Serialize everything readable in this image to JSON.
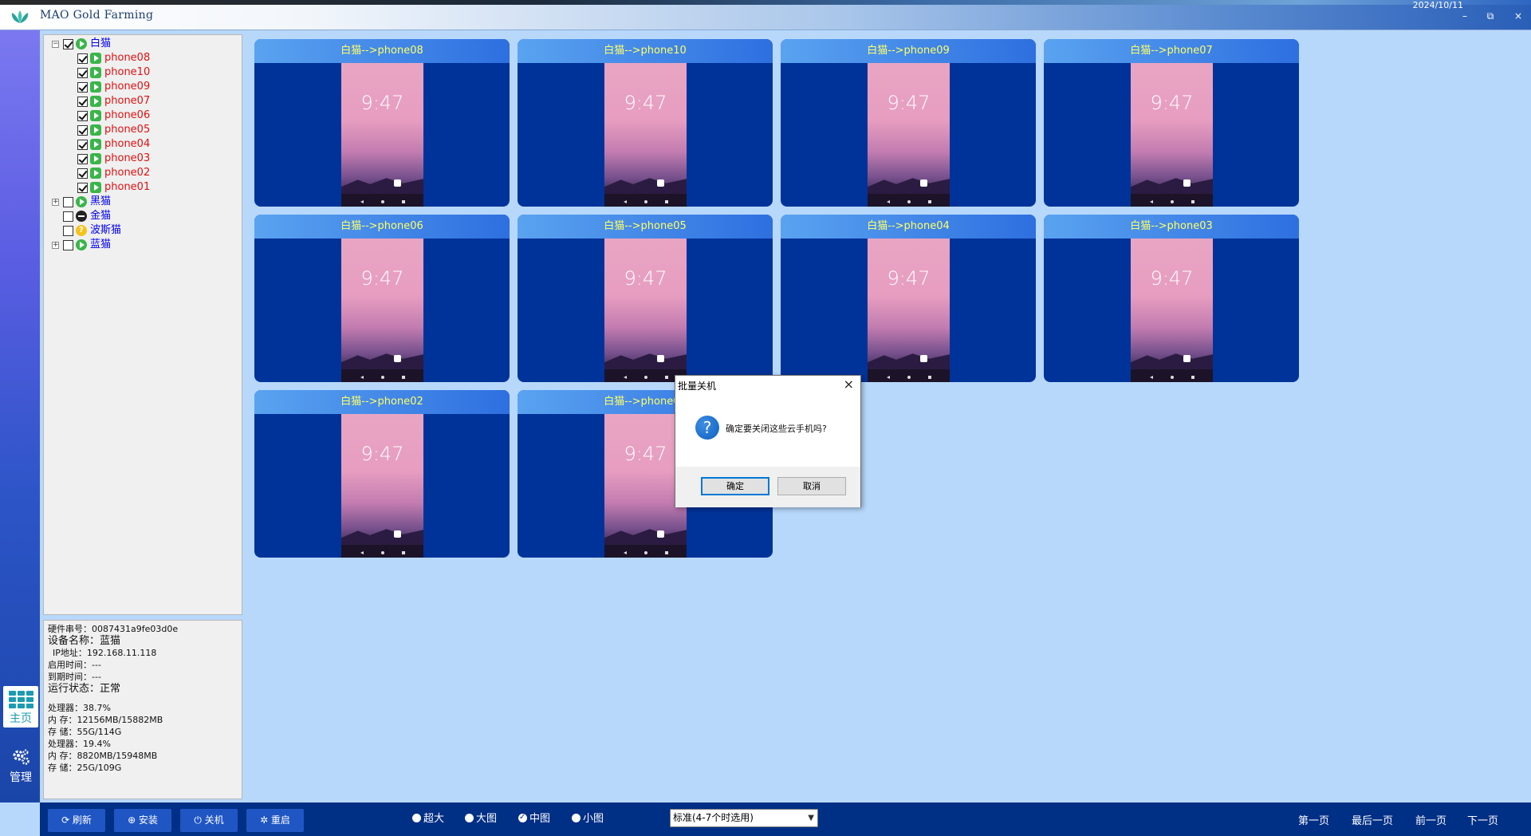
{
  "app": {
    "title": "MAO Gold Farming",
    "date_partial": "2024/10/11",
    "window_buttons": {
      "minimize": "–",
      "restore": "⧉",
      "close": "×"
    }
  },
  "leftnav": {
    "home_label": "主页",
    "manage_label": "管理"
  },
  "tree": {
    "groups": [
      {
        "label": "白猫",
        "expanded": true,
        "checked": true,
        "status": "running",
        "children": [
          {
            "label": "phone08",
            "checked": true
          },
          {
            "label": "phone10",
            "checked": true
          },
          {
            "label": "phone09",
            "checked": true
          },
          {
            "label": "phone07",
            "checked": true
          },
          {
            "label": "phone06",
            "checked": true
          },
          {
            "label": "phone05",
            "checked": true
          },
          {
            "label": "phone04",
            "checked": true
          },
          {
            "label": "phone03",
            "checked": true
          },
          {
            "label": "phone02",
            "checked": true
          },
          {
            "label": "phone01",
            "checked": true
          }
        ]
      },
      {
        "label": "黑猫",
        "expanded": false,
        "checked": false,
        "status": "running"
      },
      {
        "label": "金猫",
        "expanded": false,
        "checked": false,
        "status": "stopped"
      },
      {
        "label": "波斯猫",
        "expanded": false,
        "checked": false,
        "status": "warning"
      },
      {
        "label": "蓝猫",
        "expanded": false,
        "checked": false,
        "status": "running"
      }
    ]
  },
  "info": {
    "serial": "硬件串号：0087431a9fe03d0e",
    "device_name": "设备名称：蓝猫",
    "ip": "IP地址：192.168.11.118",
    "start_time": "启用时间：---",
    "expire_time": "到期时间：---",
    "run_state": "运行状态：正常",
    "cpu1": "处理器：38.7%",
    "mem1": "内 存：12156MB/15882MB",
    "disk1": "存 储：55G/114G",
    "cpu2": "处理器：19.4%",
    "mem2": "内 存：8820MB/15948MB",
    "disk2": "存 储：25G/109G"
  },
  "phones": [
    {
      "title": "白猫-->phone08",
      "time": "9:47"
    },
    {
      "title": "白猫-->phone10",
      "time": "9:47"
    },
    {
      "title": "白猫-->phone09",
      "time": "9:47"
    },
    {
      "title": "白猫-->phone07",
      "time": "9:47"
    },
    {
      "title": "白猫-->phone06",
      "time": "9:47"
    },
    {
      "title": "白猫-->phone05",
      "time": "9:47"
    },
    {
      "title": "白猫-->phone04",
      "time": "9:47"
    },
    {
      "title": "白猫-->phone03",
      "time": "9:47"
    },
    {
      "title": "白猫-->phone02",
      "time": "9:47"
    },
    {
      "title": "白猫-->phone01",
      "time": "9:47"
    }
  ],
  "dialog": {
    "title": "批量关机",
    "close": "×",
    "icon": "?",
    "message": "确定要关闭这些云手机吗?",
    "ok": "确定",
    "cancel": "取消"
  },
  "bottombar": {
    "buttons": [
      {
        "label": "⟳ 刷新",
        "icon": "refresh-icon"
      },
      {
        "label": "⊕ 安装",
        "icon": "install-icon"
      },
      {
        "label": "⏻ 关机",
        "icon": "power-icon"
      },
      {
        "label": "✲ 重启",
        "icon": "restart-icon"
      }
    ],
    "view_sizes": [
      {
        "label": "超大",
        "selected": false
      },
      {
        "label": "大图",
        "selected": false
      },
      {
        "label": "中图",
        "selected": true
      },
      {
        "label": "小图",
        "selected": false
      }
    ],
    "select_value": "标准(4-7个时选用)",
    "pager": [
      "第一页",
      "最后一页",
      "前一页",
      "下一页"
    ]
  },
  "colors": {
    "card_bg": "#003399",
    "card_header": "#2e6fe0",
    "card_title": "#ffff66",
    "page_bg": "#b7d8fb",
    "bottombar": "#002f86"
  }
}
